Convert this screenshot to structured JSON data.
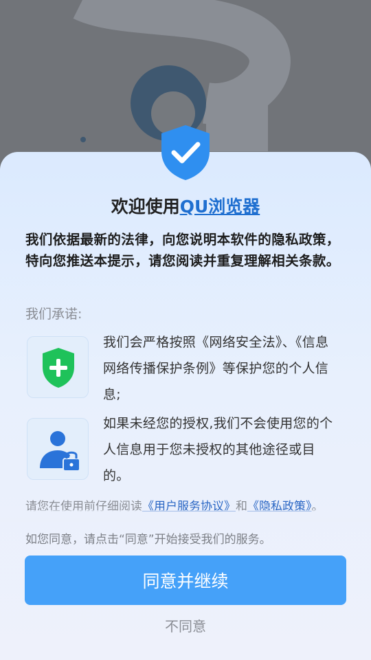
{
  "header": {
    "title_prefix": "欢迎使用",
    "title_app": "QU浏览器"
  },
  "intro": "我们依据最新的法律，向您说明本软件的隐私政策，特向您推送本提示，请您阅读并重复理解相关条款。",
  "promise_label": "我们承诺:",
  "items": [
    {
      "icon": "green-shield-plus-icon",
      "text": "我们会严格按照《网络安全法》、《信息网络传播保护条例》等保护您的个人信息;"
    },
    {
      "icon": "user-lock-icon",
      "text": "如果未经您的授权,我们不会使用您的个人信息用于您未授权的其他途径或目的。"
    }
  ],
  "agreement": {
    "prefix": "请您在使用前仔细阅读",
    "service_doc": "《用户服务协议》",
    "and": "和",
    "privacy_doc": "《隐私政策》",
    "suffix": "。"
  },
  "consent_hint": "如您同意，请点击“同意”开始接受我们的服务。",
  "buttons": {
    "agree": "同意并继续",
    "decline": "不同意"
  },
  "colors": {
    "accent": "#45a1f9",
    "link": "#1f6fd0",
    "shield": "#2f8ff0",
    "green": "#1fc25a"
  }
}
